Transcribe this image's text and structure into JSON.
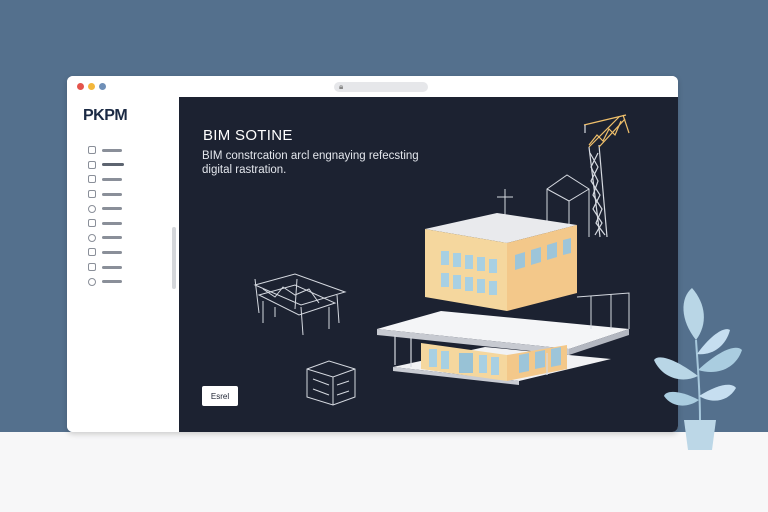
{
  "app": {
    "logo": "PKPM"
  },
  "sidebar": {
    "items": [
      {
        "icon": "document-icon"
      },
      {
        "icon": "pencil-icon",
        "active": true
      },
      {
        "icon": "folder-icon"
      },
      {
        "icon": "folder-icon"
      },
      {
        "icon": "chart-icon"
      },
      {
        "icon": "grid-icon"
      },
      {
        "icon": "circle-icon"
      },
      {
        "icon": "ruler-icon"
      },
      {
        "icon": "calendar-icon"
      },
      {
        "icon": "user-icon"
      }
    ]
  },
  "hero": {
    "title": "BIM SOTINE",
    "subtitle": "BIM constrcation arcl engnaying refecsting digital rastration.",
    "button_label": "Esrel"
  },
  "colors": {
    "desktop": "#54708d",
    "panel": "#1c2231",
    "building_wall": "#f5d79e",
    "glass": "#a8d0e3",
    "leaf": "#b9d6e6"
  }
}
